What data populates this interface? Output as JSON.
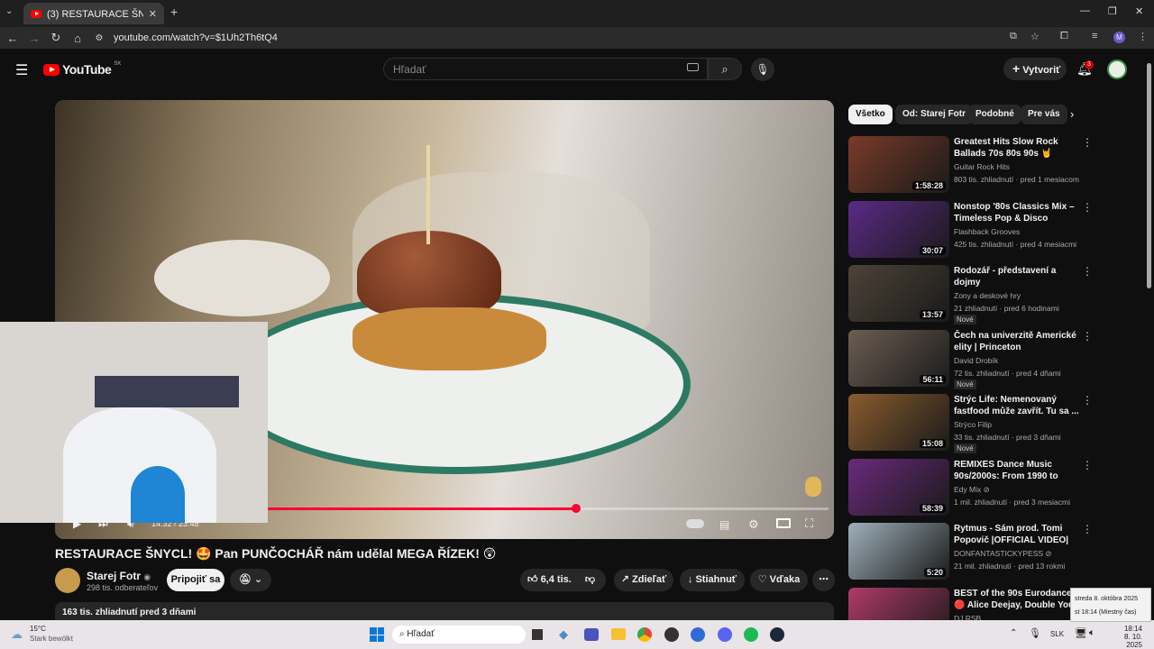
{
  "browser": {
    "tab_title": "(3) RESTAURACE ŠNYCL! 🤩 Pa",
    "url": "youtube.com/watch?v=$1Uh2Th6tQ4",
    "profile_initial": "M"
  },
  "header": {
    "logo_text": "YouTube",
    "region": "SK",
    "search_placeholder": "Hľadať",
    "create_label": "Vytvoriť",
    "notif_count": "3"
  },
  "player": {
    "time": "14:32 / 23:48",
    "progress": 0.55
  },
  "video": {
    "title": "RESTAURACE ŠNYCL! 🤩 Pan PUNČOCHÁŘ nám udělal MEGA ŘÍZEK! 😲",
    "channel": "Starej Fotr",
    "subscribers": "298 tis. odberateľov",
    "join_label": "Pripojiť sa",
    "likes": "6,4 tis.",
    "share_label": "Zdieľať",
    "download_label": "Stiahnuť",
    "thanks_label": "Vďaka",
    "description_meta": "163 tis. zhliadnutí  pred 3 dňami"
  },
  "chips": [
    "Všetko",
    "Od: Starej Fotr",
    "Podobné",
    "Pre vás"
  ],
  "recommendations": [
    {
      "title": "Greatest Hits Slow Rock Ballads 70s 80s 90s 🤘 Legendary Roc...",
      "channel": "Guitar Rock Hits",
      "meta": "803 tis. zhliadnutí · pred 1 mesiacom",
      "duration": "1:58:28",
      "badge": "",
      "thumb_color": "#7a3b28"
    },
    {
      "title": "Nonstop '80s Classics Mix – Timeless Pop & Disco Favorites",
      "channel": "Flashback Grooves",
      "meta": "425 tis. zhliadnutí · pred 4 mesiacmi",
      "duration": "30:07",
      "badge": "",
      "thumb_color": "#5b2a86"
    },
    {
      "title": "Rodozář - představení a dojmy",
      "channel": "Zony a deskové hry",
      "meta": "21 zhliadnutí · pred 6 hodinami",
      "duration": "13:57",
      "badge": "Nové",
      "thumb_color": "#4d4338"
    },
    {
      "title": "Čech na univerzitě Americké elity | Princeton",
      "channel": "David Drobík",
      "meta": "72 tis. zhliadnutí · pred 4 dňami",
      "duration": "56:11",
      "badge": "Nové",
      "thumb_color": "#6b5e52"
    },
    {
      "title": "Strýc Life: Nemenovaný fastfood může zavřít. Tu sa ...",
      "channel": "Strýco Filip",
      "meta": "33 tis. zhliadnutí · pred 3 dňami",
      "duration": "15:08",
      "badge": "Nové",
      "thumb_color": "#8a5c2e"
    },
    {
      "title": "REMIXES Dance Music 90s/2000s: From 1990 to 201...",
      "channel": "Edy Mix ⊘",
      "meta": "1 mil. zhliadnutí · pred 3 mesiacmi",
      "duration": "58:39",
      "badge": "",
      "thumb_color": "#6b2a7c"
    },
    {
      "title": "Rytmus - Sám prod. Tomi Popovič |OFFICIAL VIDEO|",
      "channel": "DONFANTASTICKYPESS ⊘",
      "meta": "21 mil. zhliadnutí · pred 13 rokmi",
      "duration": "5:20",
      "badge": "",
      "thumb_color": "#9fb0ba"
    },
    {
      "title": "BEST of the 90s Eurodance 🔴 Alice Deejay, Double You, Gigi ...",
      "channel": "DJ RSB",
      "meta": "266 tis. zhliadnutí · pred 2 týždňami",
      "duration": "",
      "badge": "",
      "thumb_color": "#b03a66"
    }
  ],
  "taskbar": {
    "weather_temp": "15°C",
    "weather_desc": "Stark bewölkt",
    "search_label": "Hľadať",
    "lang": "SLK",
    "clock_time": "18:14",
    "clock_date": "8. 10. 2025",
    "tooltip_line1": "streda 8. októbra 2025",
    "tooltip_line2": "st 18:14 (Miestny čas)"
  }
}
